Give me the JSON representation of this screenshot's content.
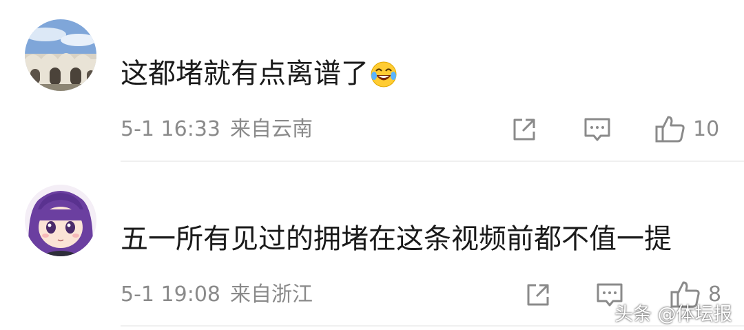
{
  "comments": [
    {
      "avatar": "avatar-building-sky",
      "text": "这都堵就有点离谱了",
      "emoji": "laughing-tears-emoji",
      "date": "5-1 16:33",
      "location": "来自云南",
      "likes": "10"
    },
    {
      "avatar": "avatar-anime-girl-purple-hair",
      "text": "五一所有见过的拥堵在这条视频前都不值一提",
      "date": "5-1 19:08",
      "location": "来自浙江",
      "likes": "8"
    }
  ],
  "icons": {
    "share": "share-icon",
    "reply": "comment-icon",
    "like": "thumbs-up-icon"
  },
  "colors": {
    "text": "#1a1a1a",
    "meta": "#8a8a8a",
    "divider": "#f0f0f0",
    "avatar2_hair": "#6b3fa0"
  },
  "watermark": "头条 @体坛报"
}
